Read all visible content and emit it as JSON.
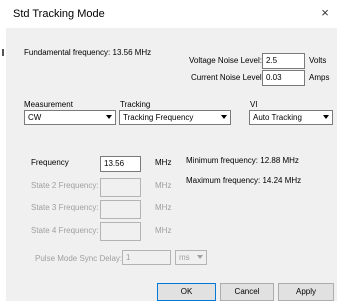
{
  "window": {
    "title": "Std Tracking Mode",
    "close_glyph": "×"
  },
  "fundamental": {
    "label": "Fundamental frequency: 13.56 MHz"
  },
  "noise": {
    "voltage_label": "Voltage Noise Level:",
    "voltage_value": "2.5",
    "voltage_unit": "Volts",
    "current_label": "Current Noise Level:",
    "current_value": "0.03",
    "current_unit": "Amps"
  },
  "measurement": {
    "label": "Measurement",
    "value": "CW"
  },
  "tracking": {
    "label": "Tracking",
    "value": "Tracking Frequency"
  },
  "vi": {
    "label": "VI",
    "value": "Auto Tracking"
  },
  "frequency": {
    "label": "Frequency",
    "value": "13.56",
    "unit": "MHz"
  },
  "states": [
    {
      "label": "State 2 Frequency:",
      "value": "",
      "unit": "MHz"
    },
    {
      "label": "State 3 Frequency:",
      "value": "",
      "unit": "MHz"
    },
    {
      "label": "State 4 Frequency:",
      "value": "",
      "unit": "MHz"
    }
  ],
  "limits": {
    "min_label": "Minimum frequency: 12.88 MHz",
    "max_label": "Maximum frequency: 14.24 MHz"
  },
  "pulse": {
    "label": "Pulse Mode Sync Delay:",
    "value": "1",
    "unit": "ms"
  },
  "buttons": {
    "ok": "OK",
    "cancel": "Cancel",
    "apply": "Apply"
  }
}
